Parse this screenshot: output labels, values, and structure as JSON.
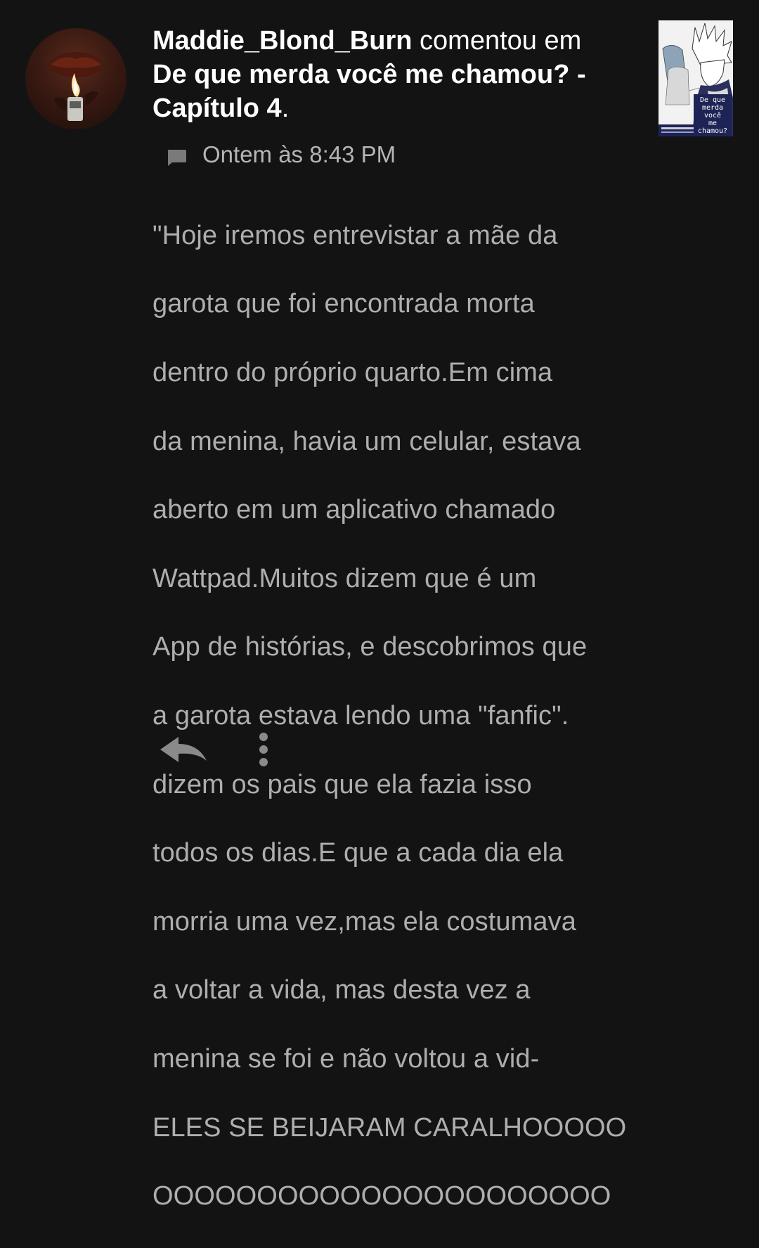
{
  "notification": {
    "username": "Maddie_Blond_Burn",
    "action_text": "comentou em",
    "story_title": "De que merda você me chamou? - Capítulo 4",
    "title_end": ".",
    "timestamp": "Ontem às 8:43 PM",
    "comment_lines": [
      "\"Hoje iremos entrevistar a mãe da",
      "garota que foi encontrada morta",
      "dentro do próprio quarto.Em cima",
      "da menina, havia um celular, estava",
      "aberto em um aplicativo chamado",
      "Wattpad.Muitos dizem que é um",
      "App de histórias, e descobrimos que",
      "a garota estava lendo uma \"fanfic\".",
      "dizem os pais que ela fazia isso",
      "todos os dias.E que a cada dia ela",
      "morria  uma vez,mas ela costumava",
      "a voltar a vida, mas desta vez a",
      "menina se foi e não voltou a vid-",
      "ELES SE BEIJARAM CARALHOOOOO",
      "OOOOOOOOOOOOOOOOOOOOOO"
    ]
  },
  "cover": {
    "title_text": "De que\nmerda\nvocê\nme chamou?"
  },
  "icons": {
    "timestamp_icon": "comment-bubble-icon",
    "reply_icon": "reply-arrow-icon",
    "more_icon": "more-vertical-icon"
  },
  "colors": {
    "background": "#131313",
    "username": "#ffffff",
    "comment_text": "#aeaeae",
    "timestamp": "#b5b5b5",
    "icon": "#7a7a7a"
  }
}
